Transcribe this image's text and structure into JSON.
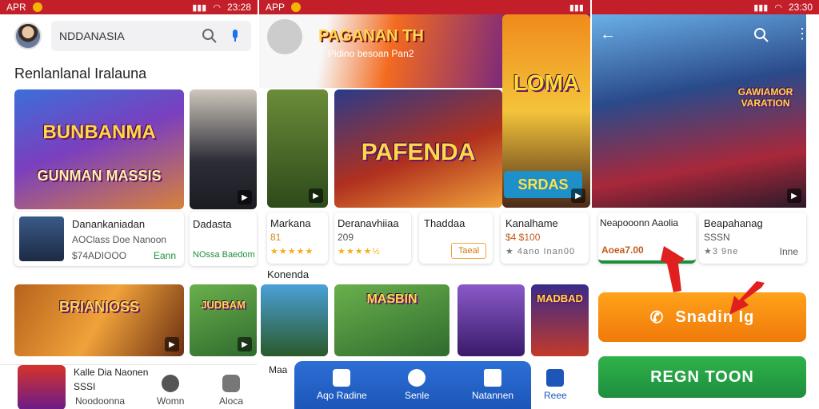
{
  "status": {
    "left_carrier": "APR",
    "time_1": "23:28",
    "center_carrier": "APP",
    "time_2": "23:30"
  },
  "panel1": {
    "search": {
      "value": "NDDANASIA"
    },
    "section_title": "Renlanlanal Iralauna",
    "hero_art_title": "BUNBANMA",
    "hero_art_sub": "GUNMAN MASSIS",
    "apps": [
      {
        "name": "Danankaniadan",
        "sub": "AOClass Doe Nanoon",
        "price": "$74ADIOOO",
        "tag": "Eann"
      },
      {
        "name": "Dadasta",
        "sub": "NOssa Baedom",
        "price": "",
        "tag": ""
      }
    ],
    "row2_art": [
      "BRIANIOSS",
      "JUDBAM"
    ],
    "bottom_app_name": "Kalle Dia Naonen",
    "bottom_app_sub": "SSSI",
    "nav": [
      "Noodoonna",
      "Womn",
      "Aloca"
    ]
  },
  "panel2": {
    "banner_title": "PAGANAN TH",
    "banner_sub": "Pidino besoan Pan2",
    "hero_titles": [
      "PAFENDA",
      "LOMA",
      "SRDAS"
    ],
    "apps": [
      {
        "name": "Markana",
        "sub": "81",
        "rating": "★★★★★"
      },
      {
        "name": "Deranavhiiaa",
        "sub": "209",
        "rating": "★★★★½"
      },
      {
        "name": "Thaddaa",
        "sub": "",
        "rating": "",
        "button": "Taeal"
      },
      {
        "name": "Kanalhame",
        "sub": "$4 $100",
        "rating": "★ 4ano Inan00"
      }
    ],
    "section2": "Konenda",
    "row2_art": [
      "MASBIN",
      "MADBAD"
    ],
    "bottom_left": "Maa",
    "nav": [
      "Aqo Radine",
      "Senle",
      "Natannen",
      "Reee"
    ]
  },
  "panel3": {
    "art_label": "GAWIAMOR VARATION",
    "apps": [
      {
        "name": "Neapooonn Aaolia",
        "price": "Aoea7.00"
      },
      {
        "name": "Beapahanag",
        "sub": "SSSN",
        "rating": "★3 9ne",
        "tag": "Inne"
      }
    ],
    "btn_orange": "Snadin Ig",
    "btn_green": "REGN TOON"
  },
  "colors": {
    "status": "#c21f2a",
    "green": "#1e8e3e",
    "orange": "#ff8a00",
    "blue": "#1c56b8"
  }
}
